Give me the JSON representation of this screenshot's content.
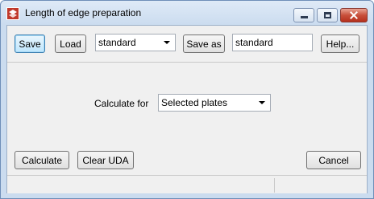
{
  "window": {
    "title": "Length of edge preparation"
  },
  "toolbar": {
    "save_label": "Save",
    "load_label": "Load",
    "setting_value": "standard",
    "save_as_label": "Save as",
    "save_as_value": "standard",
    "help_label": "Help..."
  },
  "form": {
    "calculate_for_label": "Calculate for",
    "calculate_for_value": "Selected plates"
  },
  "actions": {
    "calculate_label": "Calculate",
    "clear_uda_label": "Clear UDA",
    "cancel_label": "Cancel"
  },
  "colors": {
    "close_button": "#c8503b",
    "focused_button": "#3c7fb1"
  }
}
